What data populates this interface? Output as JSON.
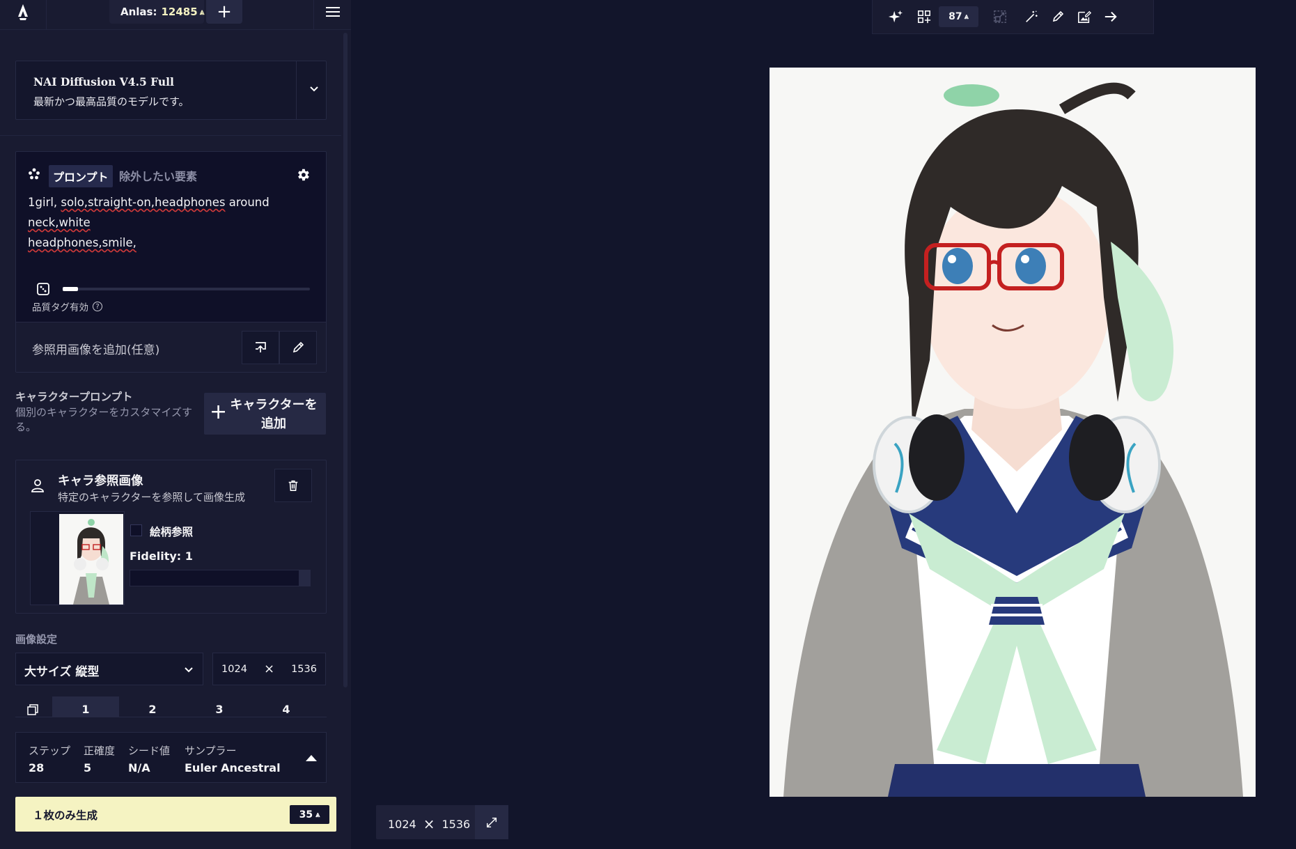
{
  "topbar": {
    "anlas_label": "Anlas:",
    "anlas_value": "12485",
    "plus": "+"
  },
  "model": {
    "name": "NAI Diffusion V4.5 Full",
    "description": "最新かつ最高品質のモデルです。"
  },
  "prompt": {
    "tab_prompt": "プロンプト",
    "tab_negative": "除外したい要素",
    "line1_a": "1girl, ",
    "line1_b": "solo,straight-on,headphones",
    "line1_c": " around ",
    "line1_d": "neck,white",
    "line2": "headphones,smile,",
    "quality_label": "品質タグ有効",
    "quality_help": "?",
    "strength": 0.06
  },
  "reference": {
    "add_label": "参照用画像を追加(任意)"
  },
  "character_prompt": {
    "title": "キャラクタープロンプト",
    "description": "個別のキャラクターをカスタマイズする。",
    "add_button": "キャラクターを追加"
  },
  "char_ref": {
    "title": "キャラ参照画像",
    "subtitle": "特定のキャラクターを参照して画像生成",
    "style_ref_label": "絵柄参照",
    "style_ref_checked": false,
    "fidelity_label": "Fidelity: 1",
    "fidelity_value": 1
  },
  "image_settings": {
    "title": "画像設定",
    "size_label": "大サイズ 縦型",
    "width": "1024",
    "height": "1536",
    "times": "×"
  },
  "batch": {
    "options": [
      "1",
      "2",
      "3",
      "4"
    ],
    "selected": "1"
  },
  "params": {
    "steps_label": "ステップ",
    "steps_value": "28",
    "guidance_label": "正確度",
    "guidance_value": "5",
    "seed_label": "シード値",
    "seed_value": "N/A",
    "sampler_label": "サンプラー",
    "sampler_value": "Euler Ancestral"
  },
  "generate": {
    "label": "１枚のみ生成",
    "cost": "35"
  },
  "toolbar": {
    "count": "87"
  },
  "output": {
    "width": "1024",
    "height": "1536",
    "times": "×"
  },
  "colors": {
    "background": "#12152b",
    "sidebar": "#191b31",
    "accent": "#f5f3c2",
    "panel": "#262944"
  }
}
